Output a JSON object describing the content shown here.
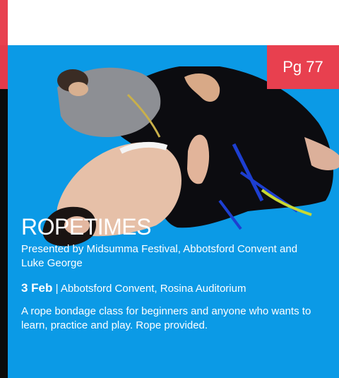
{
  "badge": {
    "page": "Pg 77"
  },
  "event": {
    "title": "ROPETIMES",
    "presenter": "Presented by Midsumma Festival, Abbotsford Convent and Luke George",
    "date": "3 Feb",
    "separator": "|",
    "venue": "Abbotsford Convent, Rosina Auditorium",
    "description": "A rope bondage class for beginners and anyone who wants to learn, practice and play. Rope provided."
  },
  "colors": {
    "panel": "#0b9ae6",
    "accent": "#e8404f",
    "strip": "#0a0a0a",
    "text": "#ffffff"
  }
}
